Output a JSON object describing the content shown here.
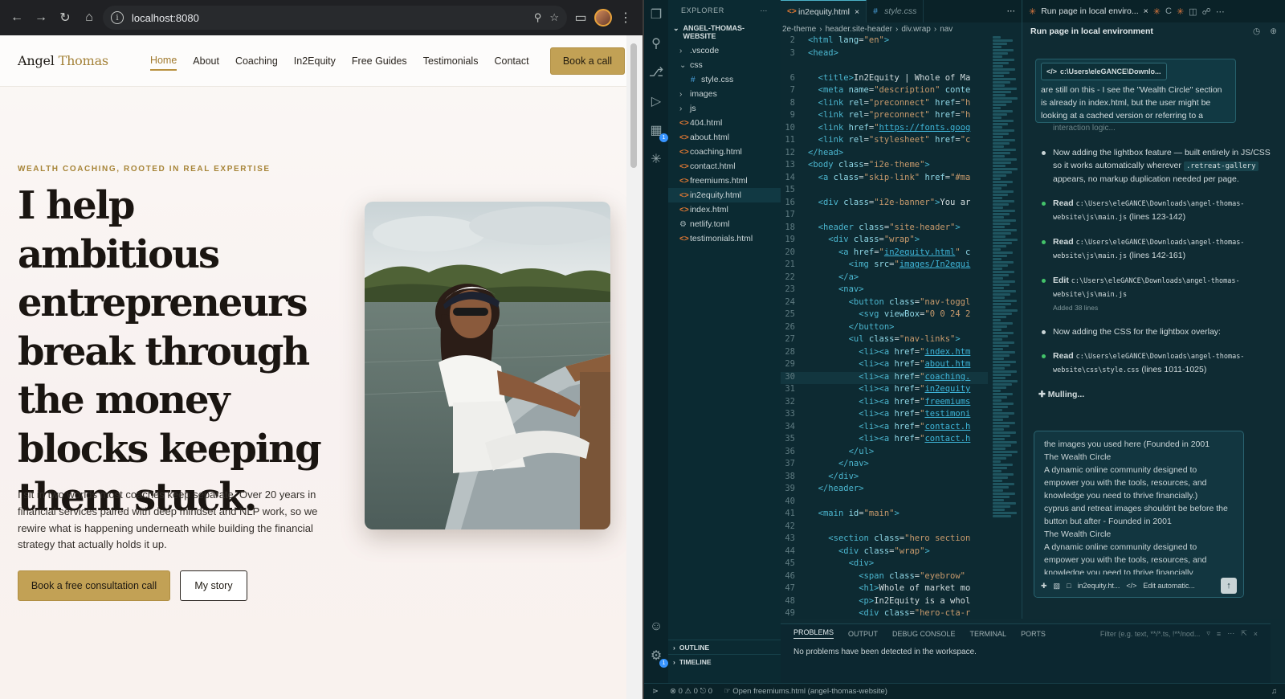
{
  "browser": {
    "url": "localhost:8080"
  },
  "site": {
    "logo_first": "Angel",
    "logo_last": "Thomas",
    "nav": [
      "Home",
      "About",
      "Coaching",
      "In2Equity",
      "Free Guides",
      "Testimonials",
      "Contact"
    ],
    "nav_active": "Home",
    "header_cta": "Book a call",
    "eyebrow": "WEALTH COACHING, ROOTED IN REAL EXPERTISE",
    "headline": "I help ambitious entrepreneurs break through the money blocks keeping them stuck.",
    "lede": "I sit in two worlds most coaches keep separate. Over 20 years in financial services paired with deep mindset and NLP work, so we rewire what is happening underneath while building the financial strategy that actually holds it up.",
    "primary_cta": "Book a free consultation call",
    "secondary_cta": "My story"
  },
  "explorer": {
    "title": "EXPLORER",
    "project": "ANGEL-THOMAS-WEBSITE",
    "items": [
      {
        "name": ".vscode",
        "type": "folder",
        "open": false,
        "level": 1
      },
      {
        "name": "css",
        "type": "folder",
        "open": true,
        "level": 1
      },
      {
        "name": "style.css",
        "type": "css",
        "level": 2
      },
      {
        "name": "images",
        "type": "folder",
        "open": false,
        "level": 1
      },
      {
        "name": "js",
        "type": "folder",
        "open": false,
        "level": 1
      },
      {
        "name": "404.html",
        "type": "html",
        "level": 1
      },
      {
        "name": "about.html",
        "type": "html",
        "level": 1
      },
      {
        "name": "coaching.html",
        "type": "html",
        "level": 1
      },
      {
        "name": "contact.html",
        "type": "html",
        "level": 1
      },
      {
        "name": "freemiums.html",
        "type": "html",
        "level": 1
      },
      {
        "name": "in2equity.html",
        "type": "html",
        "level": 1,
        "selected": true
      },
      {
        "name": "index.html",
        "type": "html",
        "level": 1
      },
      {
        "name": "netlify.toml",
        "type": "config",
        "level": 1
      },
      {
        "name": "testimonials.html",
        "type": "html",
        "level": 1
      }
    ],
    "outline": "OUTLINE",
    "timeline": "TIMELINE"
  },
  "editor": {
    "tabs": [
      {
        "label": "in2equity.html",
        "active": true
      },
      {
        "label": "style.css",
        "active": false
      }
    ],
    "breadcrumb": [
      "2e-theme",
      "header.site-header",
      "div.wrap",
      "nav"
    ],
    "lines": [
      {
        "n": "2",
        "html": "<span class='tg'>&lt;html</span> <span class='at'>lang</span>=<span class='st'>\"en\"</span><span class='tg'>&gt;</span>"
      },
      {
        "n": "3",
        "html": "<span class='tg'>&lt;head&gt;</span>"
      },
      {
        "n": "",
        "html": ""
      },
      {
        "n": "6",
        "html": "  <span class='tg'>&lt;title&gt;</span><span class='tx'>In2Equity | Whole of Ma</span>"
      },
      {
        "n": "7",
        "html": "  <span class='tg'>&lt;meta</span> <span class='at'>name</span>=<span class='st'>\"description\"</span> <span class='at'>conte</span>"
      },
      {
        "n": "8",
        "html": "  <span class='tg'>&lt;link</span> <span class='at'>rel</span>=<span class='st'>\"preconnect\"</span> <span class='at'>href</span>=<span class='st'>\"h</span>"
      },
      {
        "n": "9",
        "html": "  <span class='tg'>&lt;link</span> <span class='at'>rel</span>=<span class='st'>\"preconnect\"</span> <span class='at'>href</span>=<span class='st'>\"h</span>"
      },
      {
        "n": "10",
        "html": "  <span class='tg'>&lt;link</span> <span class='at'>href</span>=<span class='st'>\"</span><span class='us'>https://fonts.goog</span>"
      },
      {
        "n": "11",
        "html": "  <span class='tg'>&lt;link</span> <span class='at'>rel</span>=<span class='st'>\"stylesheet\"</span> <span class='at'>href</span>=<span class='st'>\"c</span>"
      },
      {
        "n": "12",
        "html": "<span class='tg'>&lt;/head&gt;</span>"
      },
      {
        "n": "13",
        "html": "<span class='tg'>&lt;body</span> <span class='at'>class</span>=<span class='st'>\"i2e-theme\"</span><span class='tg'>&gt;</span>"
      },
      {
        "n": "14",
        "html": "  <span class='tg'>&lt;a</span> <span class='at'>class</span>=<span class='st'>\"skip-link\"</span> <span class='at'>href</span>=<span class='st'>\"#ma</span>"
      },
      {
        "n": "15",
        "html": ""
      },
      {
        "n": "16",
        "html": "  <span class='tg'>&lt;div</span> <span class='at'>class</span>=<span class='st'>\"i2e-banner\"</span><span class='tg'>&gt;</span><span class='tx'>You ar</span>"
      },
      {
        "n": "17",
        "html": ""
      },
      {
        "n": "18",
        "html": "  <span class='tg'>&lt;header</span> <span class='at'>class</span>=<span class='st'>\"site-header\"</span><span class='tg'>&gt;</span>"
      },
      {
        "n": "19",
        "html": "    <span class='tg'>&lt;div</span> <span class='at'>class</span>=<span class='st'>\"wrap\"</span><span class='tg'>&gt;</span>"
      },
      {
        "n": "20",
        "html": "      <span class='tg'>&lt;a</span> <span class='at'>href</span>=<span class='st'>\"</span><span class='us'>in2equity.html</span><span class='st'>\"</span> <span class='at'>c</span>"
      },
      {
        "n": "21",
        "html": "        <span class='tg'>&lt;img</span> <span class='at'>src</span>=<span class='st'>\"</span><span class='us'>images/In2equi</span>"
      },
      {
        "n": "22",
        "html": "      <span class='tg'>&lt;/a&gt;</span>"
      },
      {
        "n": "23",
        "html": "      <span class='tg'>&lt;nav&gt;</span>"
      },
      {
        "n": "24",
        "html": "        <span class='tg'>&lt;button</span> <span class='at'>class</span>=<span class='st'>\"nav-toggl</span>"
      },
      {
        "n": "25",
        "html": "          <span class='tg'>&lt;svg</span> <span class='at'>viewBox</span>=<span class='st'>\"0 0 24 2</span>"
      },
      {
        "n": "26",
        "html": "        <span class='tg'>&lt;/button&gt;</span>"
      },
      {
        "n": "27",
        "html": "        <span class='tg'>&lt;ul</span> <span class='at'>class</span>=<span class='st'>\"nav-links\"</span><span class='tg'>&gt;</span>"
      },
      {
        "n": "28",
        "html": "          <span class='tg'>&lt;li&gt;&lt;a</span> <span class='at'>href</span>=<span class='st'>\"</span><span class='us'>index.htm</span>"
      },
      {
        "n": "29",
        "html": "          <span class='tg'>&lt;li&gt;&lt;a</span> <span class='at'>href</span>=<span class='st'>\"</span><span class='us'>about.htm</span>"
      },
      {
        "n": "30",
        "html": "          <span class='tg'>&lt;li&gt;&lt;a</span> <span class='at'>href</span>=<span class='st'>\"</span><span class='us'>coaching.</span>",
        "hl": true
      },
      {
        "n": "31",
        "html": "          <span class='tg'>&lt;li&gt;&lt;a</span> <span class='at'>href</span>=<span class='st'>\"</span><span class='us'>in2equity</span>"
      },
      {
        "n": "32",
        "html": "          <span class='tg'>&lt;li&gt;&lt;a</span> <span class='at'>href</span>=<span class='st'>\"</span><span class='us'>freemiums</span>"
      },
      {
        "n": "33",
        "html": "          <span class='tg'>&lt;li&gt;&lt;a</span> <span class='at'>href</span>=<span class='st'>\"</span><span class='us'>testimoni</span>"
      },
      {
        "n": "34",
        "html": "          <span class='tg'>&lt;li&gt;&lt;a</span> <span class='at'>href</span>=<span class='st'>\"</span><span class='us'>contact.h</span>"
      },
      {
        "n": "35",
        "html": "          <span class='tg'>&lt;li&gt;&lt;a</span> <span class='at'>href</span>=<span class='st'>\"</span><span class='us'>contact.h</span>"
      },
      {
        "n": "36",
        "html": "        <span class='tg'>&lt;/ul&gt;</span>"
      },
      {
        "n": "37",
        "html": "      <span class='tg'>&lt;/nav&gt;</span>"
      },
      {
        "n": "38",
        "html": "    <span class='tg'>&lt;/div&gt;</span>"
      },
      {
        "n": "39",
        "html": "  <span class='tg'>&lt;/header&gt;</span>"
      },
      {
        "n": "40",
        "html": ""
      },
      {
        "n": "41",
        "html": "  <span class='tg'>&lt;main</span> <span class='at'>id</span>=<span class='st'>\"main\"</span><span class='tg'>&gt;</span>"
      },
      {
        "n": "42",
        "html": ""
      },
      {
        "n": "43",
        "html": "    <span class='tg'>&lt;section</span> <span class='at'>class</span>=<span class='st'>\"hero section</span>"
      },
      {
        "n": "44",
        "html": "      <span class='tg'>&lt;div</span> <span class='at'>class</span>=<span class='st'>\"wrap\"</span><span class='tg'>&gt;</span>"
      },
      {
        "n": "45",
        "html": "        <span class='tg'>&lt;div&gt;</span>"
      },
      {
        "n": "46",
        "html": "          <span class='tg'>&lt;span</span> <span class='at'>class</span>=<span class='st'>\"eyebrow\"</span>"
      },
      {
        "n": "47",
        "html": "          <span class='tg'>&lt;h1&gt;</span><span class='tx'>Whole of market mo</span>"
      },
      {
        "n": "48",
        "html": "          <span class='tg'>&lt;p&gt;</span><span class='tx'>In2Equity is a whol</span>"
      },
      {
        "n": "49",
        "html": "          <span class='tg'>&lt;div</span> <span class='at'>class</span>=<span class='st'>\"hero-cta-r</span>"
      }
    ]
  },
  "panel": {
    "tabs": [
      "PROBLEMS",
      "OUTPUT",
      "DEBUG CONSOLE",
      "TERMINAL",
      "PORTS"
    ],
    "active_tab": "PROBLEMS",
    "filter_placeholder": "Filter (e.g. text, **/*.ts, !**/nod...",
    "message": "No problems have been detected in the workspace."
  },
  "statusbar": {
    "errors": "0",
    "warnings": "0",
    "warnings_suffix": "0",
    "action": "Open freemiums.html (angel-thomas-website)"
  },
  "chat": {
    "tab_title": "Run page in local enviro...",
    "title": "Run page in local environment",
    "context_pill": "c:\\Users\\eleGANCE\\Downlo...",
    "context_text": "are still on this - I see the \"Wealth Circle\" section is already in index.html, but the user might be looking at a cached version or referring to a",
    "fade_line": "interaction logic...",
    "msg1_before": "Now adding the lightbox feature — built entirely in JS/CSS so it works automatically wherever ",
    "msg1_code": ".retreat-gallery",
    "msg1_after": " appears, no markup duplication needed per page.",
    "read1_label": "Read",
    "read1_path": "c:\\Users\\eleGANCE\\Downloads\\angel-thomas-website\\js\\main.js",
    "read1_lines": "(lines 123-142)",
    "read2_label": "Read",
    "read2_path": "c:\\Users\\eleGANCE\\Downloads\\angel-thomas-website\\js\\main.js",
    "read2_lines": "(lines 142-161)",
    "edit_label": "Edit",
    "edit_path": "c:\\Users\\eleGANCE\\Downloads\\angel-thomas-website\\js\\main.js",
    "edit_sub": "Added 38 lines",
    "msg2": "Now adding the CSS for the lightbox overlay:",
    "read3_label": "Read",
    "read3_path": "c:\\Users\\eleGANCE\\Downloads\\angel-thomas-website\\css\\style.css",
    "read3_lines": "(lines 1011-1025)",
    "mulling": "Mulling...",
    "input_text": "the images you used here (Founded in 2001\nThe Wealth Circle\nA dynamic online community designed to empower you with the tools, resources, and knowledge you need to thrive financially.)\ncyprus and retreat images shouldnt be before the button but after - Founded in 2001\nThe Wealth Circle\nA dynamic online community designed to empower you with the tools, resources, and knowledge you need to thrive financially.",
    "attach_file": "in2equity.ht...",
    "mode": "Edit automatic..."
  }
}
